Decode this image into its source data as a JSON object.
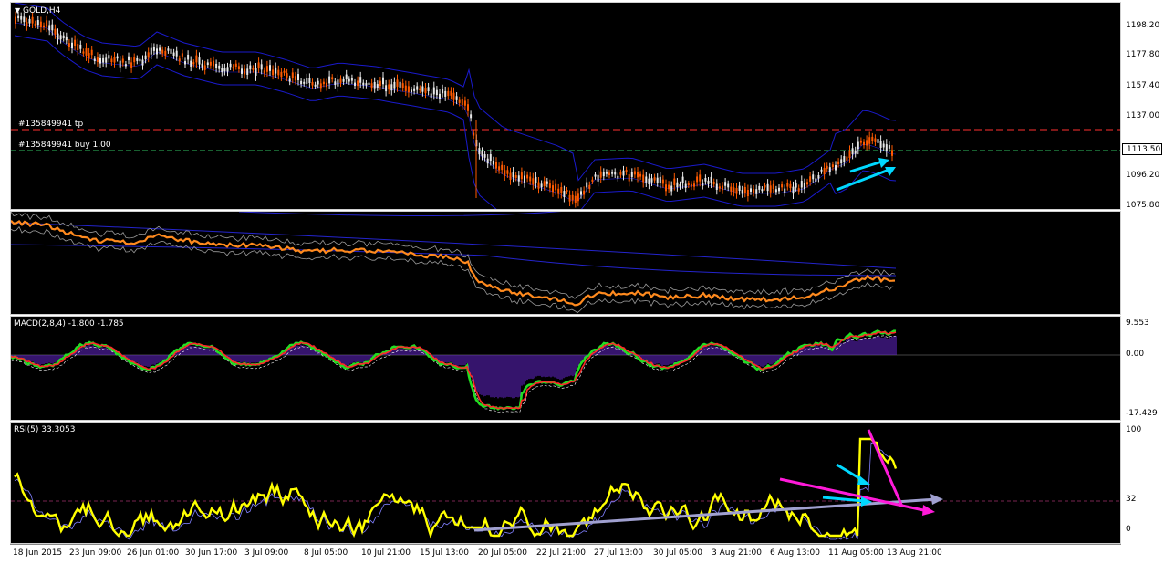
{
  "window": {
    "title": "GOLD,H4"
  },
  "price_pane": {
    "ticks": [
      "1198.20",
      "1177.80",
      "1157.40",
      "1137.00",
      "1113.50",
      "1096.20",
      "1075.80"
    ],
    "current_price": "1113.50",
    "orders": {
      "tp_label": "#135849941 tp",
      "buy_label": "#135849941 buy 1.00"
    },
    "colors": {
      "bull": "#e8e8e8",
      "bear": "#ff5a00",
      "bands": "#1a1acc",
      "tp_line": "#ff3030",
      "entry_line": "#30c060",
      "arrows": "#00d8ff"
    }
  },
  "ma_pane": {
    "colors": {
      "line": "#ff8a1e",
      "slow": "#2424cc",
      "envelope": "#9a9a9a"
    }
  },
  "macd_pane": {
    "label": "MACD(2,8,4) -1.800 -1.785",
    "ticks": [
      "9.553",
      "0.00",
      "-17.429"
    ],
    "colors": {
      "hist": "#6a28d8",
      "fast": "#22dd22",
      "signal": "#ff2a2a"
    }
  },
  "rsi_pane": {
    "label": "RSI(5) 33.3053",
    "ticks": [
      "100",
      "32",
      "0"
    ],
    "colors": {
      "rsi": "#ffff00",
      "trend_up": "#a0a0d0",
      "trend_down": "#ff1ad9",
      "arrows": "#00d8ff"
    }
  },
  "x_axis": {
    "labels": [
      "18 Jun 2015",
      "23 Jun 09:00",
      "26 Jun 01:00",
      "30 Jun 17:00",
      "3 Jul 09:00",
      "8 Jul 05:00",
      "10 Jul 21:00",
      "15 Jul 13:00",
      "20 Jul 05:00",
      "22 Jul 21:00",
      "27 Jul 13:00",
      "30 Jul 05:00",
      "3 Aug 21:00",
      "6 Aug 13:00",
      "11 Aug 05:00",
      "13 Aug 21:00"
    ]
  }
}
